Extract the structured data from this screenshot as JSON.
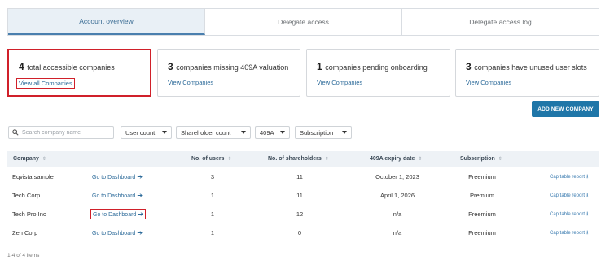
{
  "tabs": [
    {
      "label": "Account overview",
      "active": true
    },
    {
      "label": "Delegate access",
      "active": false
    },
    {
      "label": "Delegate access log",
      "active": false
    }
  ],
  "cards": [
    {
      "count": "4",
      "text": "total accessible companies",
      "link": "View all Companies"
    },
    {
      "count": "3",
      "text": "companies missing 409A valuation",
      "link": "View Companies"
    },
    {
      "count": "1",
      "text": "companies pending onboarding",
      "link": "View Companies"
    },
    {
      "count": "3",
      "text": "companies have unused user slots",
      "link": "View Companies"
    }
  ],
  "add_button": "ADD NEW COMPANY",
  "filters": {
    "search_placeholder": "Search company name",
    "dropdowns": [
      "User count",
      "Shareholder count",
      "409A",
      "Subscription"
    ]
  },
  "table": {
    "headers": [
      "Company",
      "No. of users",
      "No. of shareholders",
      "409A expiry date",
      "Subscription"
    ],
    "rows": [
      {
        "company": "Eqvista sample",
        "dashboard": "Go to Dashboard",
        "users": "3",
        "shareholders": "11",
        "expiry": "October 1, 2023",
        "subscription": "Freemium",
        "report": "Cap table report"
      },
      {
        "company": "Tech Corp",
        "dashboard": "Go to Dashboard",
        "users": "1",
        "shareholders": "11",
        "expiry": "April 1, 2026",
        "subscription": "Premium",
        "report": "Cap table report"
      },
      {
        "company": "Tech Pro Inc",
        "dashboard": "Go to Dashboard",
        "users": "1",
        "shareholders": "12",
        "expiry": "n/a",
        "subscription": "Freemium",
        "report": "Cap table report"
      },
      {
        "company": "Zen Corp",
        "dashboard": "Go to Dashboard",
        "users": "1",
        "shareholders": "0",
        "expiry": "n/a",
        "subscription": "Freemium",
        "report": "Cap table report"
      }
    ]
  },
  "footer": "1-4 of 4 items",
  "colors": {
    "accent": "#1f76a8",
    "highlight": "#d0202a",
    "link": "#2d6b9a"
  }
}
